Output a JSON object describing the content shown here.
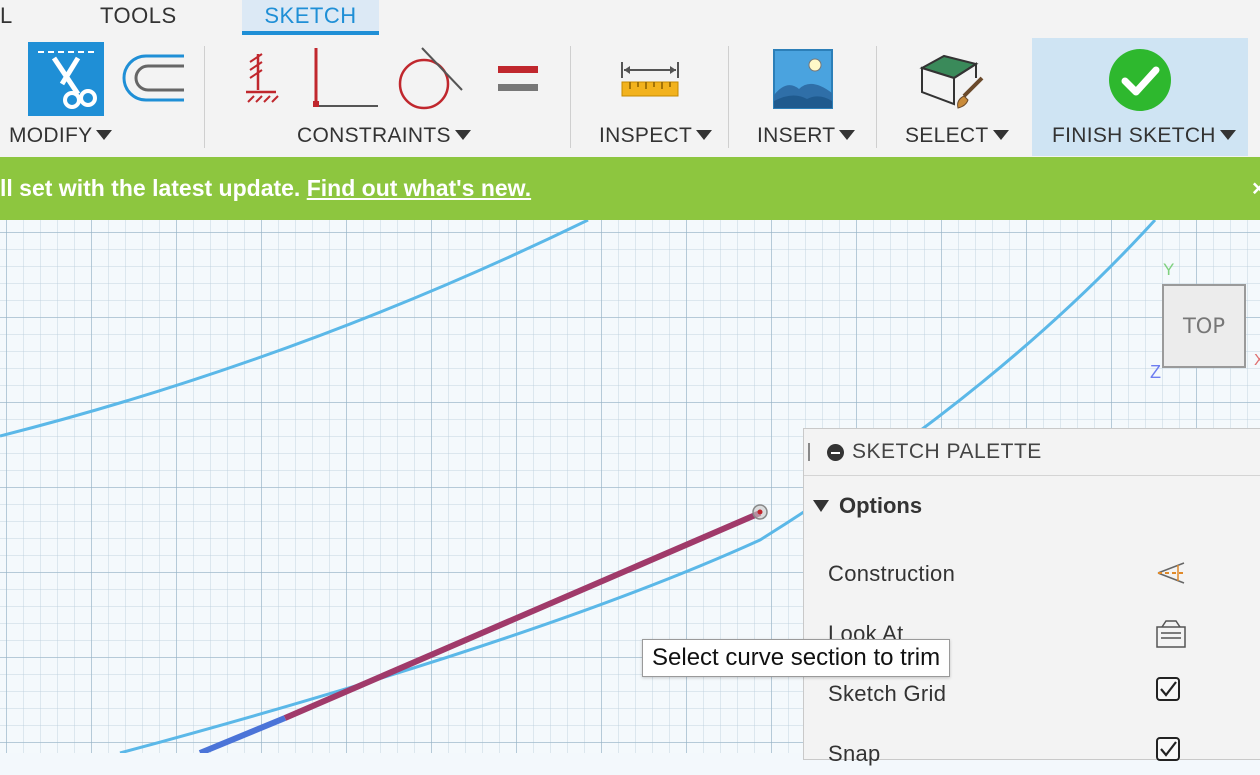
{
  "tabs": {
    "partial": "L",
    "tools": "TOOLS",
    "sketch": "SKETCH"
  },
  "groups": {
    "modify": "MODIFY",
    "constraints": "CONSTRAINTS",
    "inspect": "INSPECT",
    "insert": "INSERT",
    "select": "SELECT",
    "finish_sketch": "FINISH SKETCH"
  },
  "banner": {
    "text": "ll set with the latest update.",
    "link": "Find out what's new.",
    "close": "×"
  },
  "viewcube": {
    "face": "TOP",
    "axis_y": "Y",
    "axis_z": "Z",
    "axis_x": "X"
  },
  "tooltip": "Select curve section to trim",
  "palette": {
    "title": "SKETCH PALETTE",
    "section": "Options",
    "options": [
      {
        "label": "Construction"
      },
      {
        "label": "Look At"
      },
      {
        "label": "Sketch Grid",
        "checked": true
      },
      {
        "label": "Snap",
        "checked": true
      }
    ]
  },
  "colors": {
    "accent": "#1f8fd6",
    "banner": "#8dc63f",
    "finish": "#2eb82e",
    "curve": "#5bb8e8",
    "selected": "#a03a6a"
  }
}
